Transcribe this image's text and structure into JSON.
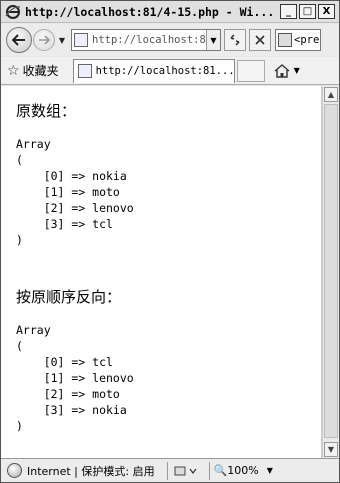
{
  "window": {
    "title": "http://localhost:81/4-15.php - Wi...",
    "buttons": {
      "minimize": "_",
      "maximize": "□",
      "close": "X"
    }
  },
  "nav": {
    "address_value": "http://localhost:8",
    "search_value": "<pre"
  },
  "favorites": {
    "label": "收藏夹"
  },
  "tab": {
    "title": "http://localhost:81..."
  },
  "content": {
    "heading1": "原数组：",
    "array1": "Array\n(\n    [0] => nokia\n    [1] => moto\n    [2] => lenovo\n    [3] => tcl\n)",
    "heading2": "按原顺序反向：",
    "array2": "Array\n(\n    [0] => tcl\n    [1] => lenovo\n    [2] => moto\n    [3] => nokia\n)"
  },
  "status": {
    "zone": "Internet | 保护模式: 启用",
    "zoom": "100%"
  }
}
